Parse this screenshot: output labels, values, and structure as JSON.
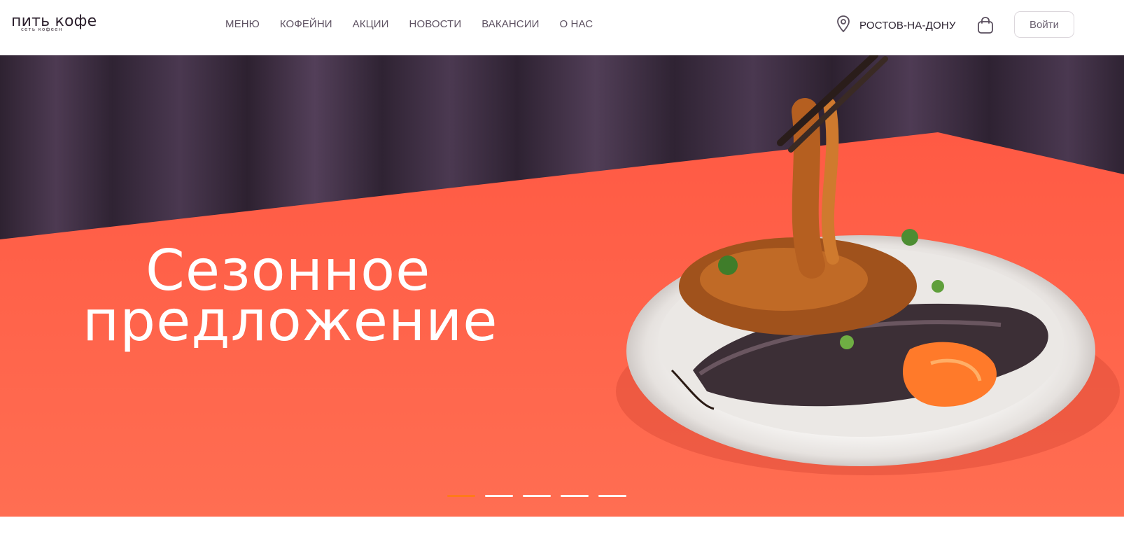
{
  "brand": {
    "name": "пить кофе",
    "tagline": "сеть кофеен"
  },
  "nav": {
    "items": [
      {
        "label": "МЕНЮ"
      },
      {
        "label": "КОФЕЙНИ"
      },
      {
        "label": "АКЦИИ"
      },
      {
        "label": "НОВОСТИ"
      },
      {
        "label": "ВАКАНСИИ"
      },
      {
        "label": "О НАС"
      }
    ]
  },
  "header": {
    "city": "РОСТОВ-НА-ДОНУ",
    "city_icon": "location-pin-icon",
    "cart_icon": "shopping-bag-icon",
    "login_label": "Войти"
  },
  "hero": {
    "title_line1": "Сезонное",
    "title_line2": "предложение",
    "slides_total": 5,
    "active_slide": 1
  },
  "colors": {
    "accent": "#ff6a50",
    "background_dark": "#3a2b3d",
    "active_indicator": "#ff7a1a"
  }
}
